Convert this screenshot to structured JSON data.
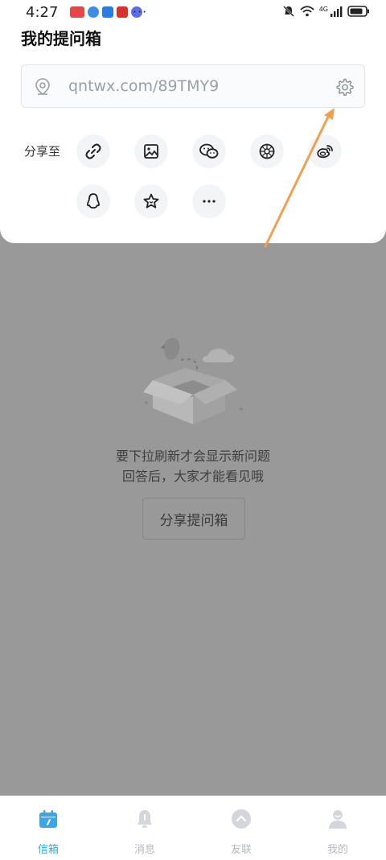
{
  "status_bar": {
    "time": "4:27",
    "more": "···",
    "network": "4G"
  },
  "share_sheet": {
    "title": "我的提问箱",
    "url": "qntwx.com/89TMY9",
    "share_label": "分享至",
    "share_options": [
      {
        "icon": "link-icon"
      },
      {
        "icon": "image-icon"
      },
      {
        "icon": "wechat-icon"
      },
      {
        "icon": "moments-icon"
      },
      {
        "icon": "weibo-icon"
      },
      {
        "icon": "qq-icon"
      },
      {
        "icon": "star-icon"
      },
      {
        "icon": "more-icon"
      }
    ]
  },
  "empty_state": {
    "line1": "要下拉刷新才会显示新问题",
    "line2": "回答后，大家才能看见哦",
    "button_label": "分享提问箱"
  },
  "tabs": [
    {
      "label": "信箱",
      "active": true
    },
    {
      "label": "消息",
      "active": false
    },
    {
      "label": "友联",
      "active": false
    },
    {
      "label": "我的",
      "active": false
    }
  ],
  "colors": {
    "accent": "#3ba5e8",
    "annotation_arrow": "#f0a050",
    "overlay": "#999999"
  }
}
